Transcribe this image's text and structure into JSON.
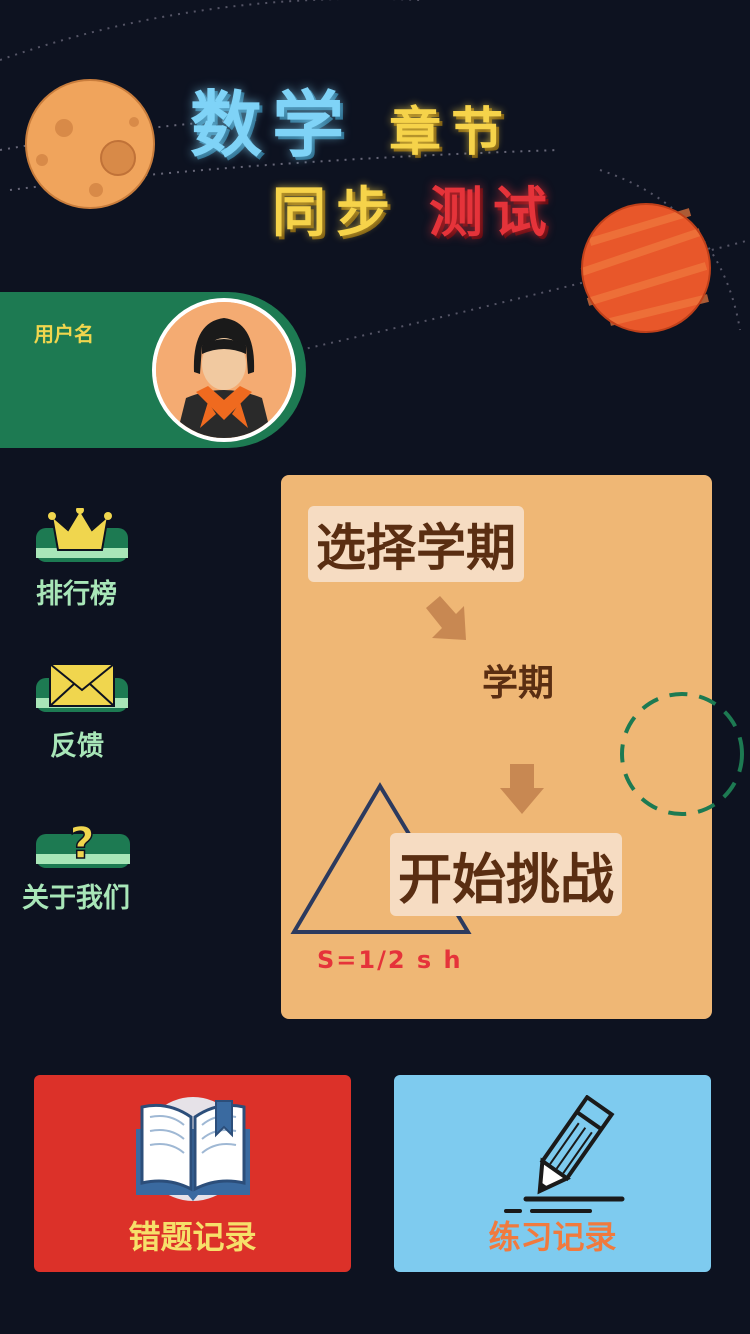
{
  "title": {
    "line1_part1": "数学",
    "line1_part2": "章节",
    "line2_part1": "同步",
    "line2_part2": "测试"
  },
  "user": {
    "name": "用户名"
  },
  "sidebar": {
    "items": [
      {
        "label": "排行榜",
        "icon": "crown-icon"
      },
      {
        "label": "反馈",
        "icon": "envelope-icon"
      },
      {
        "label": "关于我们",
        "icon": "question-icon"
      }
    ]
  },
  "main": {
    "select_term_label": "选择学期",
    "term_value": "学期",
    "start_label": "开始挑战",
    "formula": "S=1/2 s h"
  },
  "bottom": {
    "wrong_records_label": "错题记录",
    "practice_records_label": "练习记录"
  },
  "colors": {
    "background": "#0d1220",
    "user_bar": "#1d7a52",
    "panel": "#efb775",
    "wrong_button": "#dc3129",
    "practice_button": "#7ecbef"
  }
}
